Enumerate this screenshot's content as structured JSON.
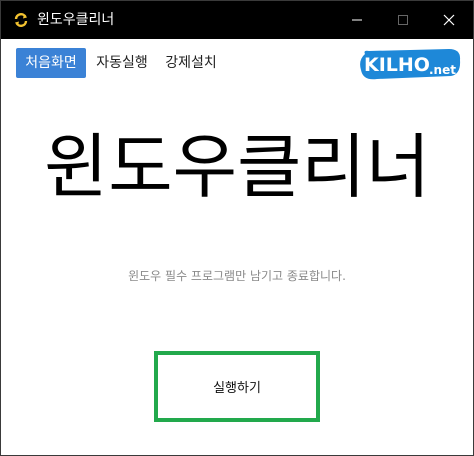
{
  "window": {
    "title": "윈도우클리너",
    "app_icon": "refresh-arrows-icon"
  },
  "window_controls": {
    "minimize": "minimize-icon",
    "maximize": "maximize-icon",
    "close": "close-icon"
  },
  "toolbar": {
    "tabs": [
      {
        "label": "처음화면",
        "active": true
      },
      {
        "label": "자동실행",
        "active": false
      },
      {
        "label": "강제설치",
        "active": false
      }
    ]
  },
  "logo": {
    "text_main": "KILHO",
    "text_suffix": ".net",
    "color_bg": "#1e88d8"
  },
  "main": {
    "headline": "윈도우클리너",
    "subtitle": "윈도우 필수 프로그램만 남기고 종료합니다.",
    "run_label": "실행하기"
  },
  "colors": {
    "titlebar": "#000000",
    "active_tab": "#3b82d6",
    "run_border": "#22a94c",
    "subtitle": "#8a8a8a"
  }
}
